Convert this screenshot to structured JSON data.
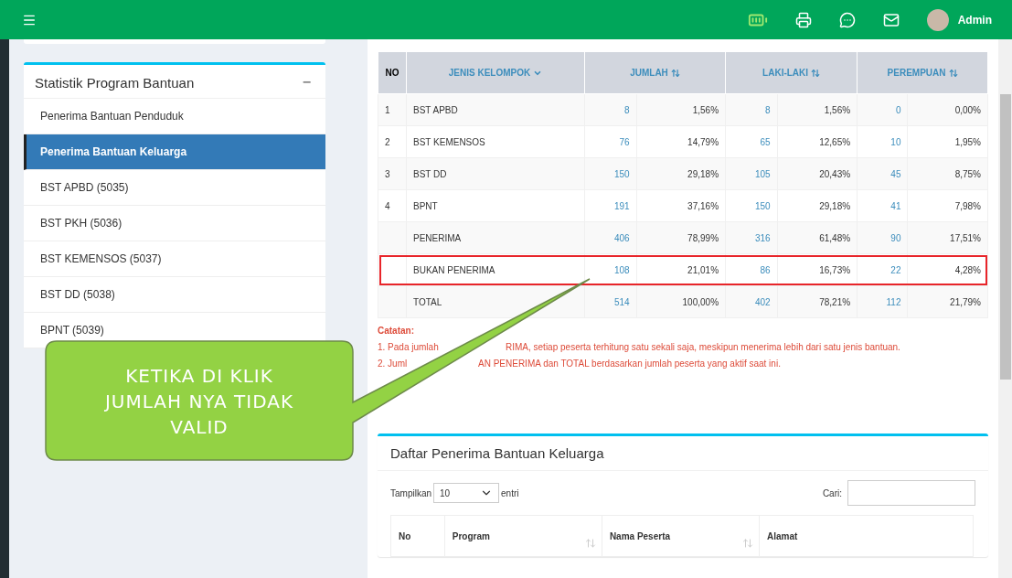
{
  "topbar": {
    "user": "Admin"
  },
  "sidebar": {
    "title": "Statistik Program Bantuan",
    "collapse": "−",
    "items": [
      {
        "label": "Penerima Bantuan Penduduk",
        "selected": false
      },
      {
        "label": "Penerima Bantuan Keluarga",
        "selected": true
      },
      {
        "label": "BST APBD (5035)",
        "selected": false
      },
      {
        "label": "BST PKH (5036)",
        "selected": false
      },
      {
        "label": "BST KEMENSOS (5037)",
        "selected": false
      },
      {
        "label": "BST DD (5038)",
        "selected": false
      },
      {
        "label": "BPNT (5039)",
        "selected": false
      }
    ]
  },
  "stats_table": {
    "columns": [
      {
        "label": "NO",
        "sortable": false
      },
      {
        "label": "JENIS KELOMPOK",
        "sortable": true,
        "sorted": true
      },
      {
        "label": "JUMLAH",
        "sortable": true,
        "sorted": false
      },
      {
        "label": "LAKI-LAKI",
        "sortable": true,
        "sorted": false
      },
      {
        "label": "PEREMPUAN",
        "sortable": true,
        "sorted": false
      }
    ],
    "rows": [
      {
        "no": "1",
        "name": "BST APBD",
        "values": [
          "8",
          "1,56%",
          "8",
          "1,56%",
          "0",
          "0,00%"
        ],
        "highlighted": false
      },
      {
        "no": "2",
        "name": "BST KEMENSOS",
        "values": [
          "76",
          "14,79%",
          "65",
          "12,65%",
          "10",
          "1,95%"
        ],
        "highlighted": false
      },
      {
        "no": "3",
        "name": "BST DD",
        "values": [
          "150",
          "29,18%",
          "105",
          "20,43%",
          "45",
          "8,75%"
        ],
        "highlighted": false
      },
      {
        "no": "4",
        "name": "BPNT",
        "values": [
          "191",
          "37,16%",
          "150",
          "29,18%",
          "41",
          "7,98%"
        ],
        "highlighted": false
      },
      {
        "name": "PENERIMA",
        "values": [
          "406",
          "78,99%",
          "316",
          "61,48%",
          "90",
          "17,51%"
        ],
        "highlighted": false
      },
      {
        "name": "BUKAN PENERIMA",
        "values": [
          "108",
          "21,01%",
          "86",
          "16,73%",
          "22",
          "4,28%"
        ],
        "highlighted": true
      },
      {
        "name": "TOTAL",
        "values": [
          "514",
          "100,00%",
          "402",
          "78,21%",
          "112",
          "21,79%"
        ],
        "highlighted": false
      }
    ]
  },
  "notes": {
    "title": "Catatan:",
    "lines": [
      {
        "before": "1. Pada jumlah",
        "after": "RIMA, setiap peserta terhitung satu sekali saja, meskipun menerima lebih dari satu jenis bantuan."
      },
      {
        "before": "2. Juml",
        "after": "AN PENERIMA dan TOTAL berdasarkan jumlah peserta yang aktif saat ini."
      }
    ]
  },
  "callout": {
    "lines": [
      "KETIKA DI KLIK",
      "JUMLAH NYA TIDAK",
      "VALID"
    ]
  },
  "list_panel": {
    "title": "Daftar Penerima Bantuan Keluarga",
    "show_label": "Tampilkan",
    "page_size": "10",
    "entries_label": "entri",
    "search_label": "Cari:",
    "columns": [
      {
        "label": "No",
        "sortable": false
      },
      {
        "label": "Program",
        "sortable": true
      },
      {
        "label": "Nama Peserta",
        "sortable": true
      },
      {
        "label": "Alamat",
        "sortable": false
      }
    ]
  }
}
